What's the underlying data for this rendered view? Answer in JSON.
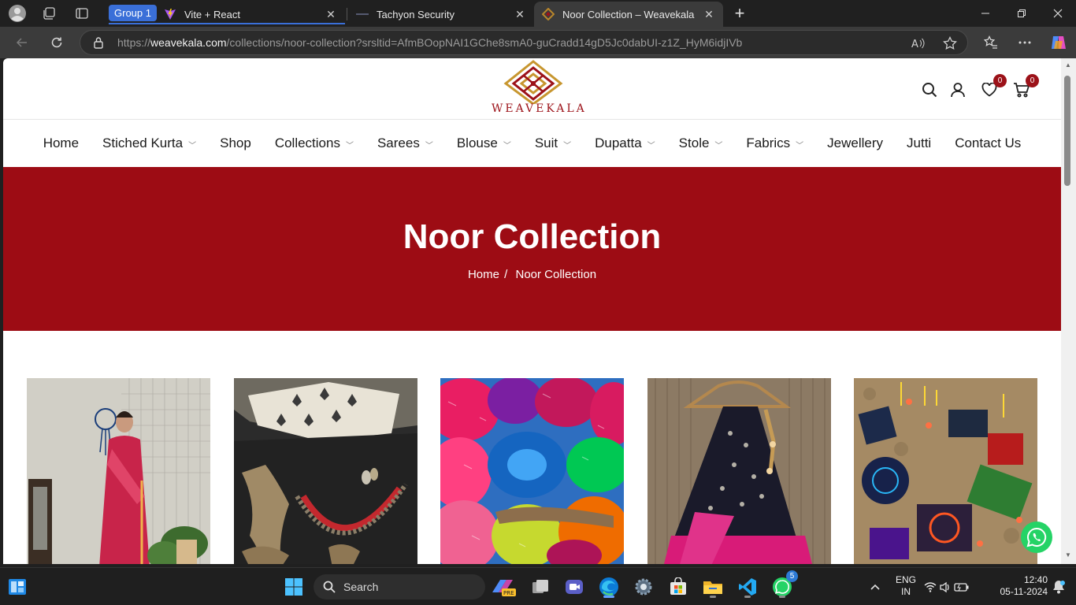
{
  "browser": {
    "tab_group_label": "Group 1",
    "tabs": [
      {
        "title": "Vite + React",
        "favicon": "vite-icon",
        "active": false
      },
      {
        "title": "Tachyon Security",
        "favicon": "tachyon-icon",
        "active": false
      },
      {
        "title": "Noor Collection – Weavekala",
        "favicon": "weavekala-icon",
        "active": true
      }
    ],
    "new_tab_symbol": "+",
    "url_prefix": "https://",
    "url_host": "weavekala.com",
    "url_path": "/collections/noor-collection?srsltid=AfmBOopNAI1GChe8smA0-guCradd14gD5Jc0dabUI-z1Z_HyM6idjIVb"
  },
  "site": {
    "logo_text": "WEAVEKALA",
    "wishlist_count": "0",
    "cart_count": "0",
    "menu": [
      {
        "label": "Home",
        "dropdown": false
      },
      {
        "label": "Stiched Kurta",
        "dropdown": true
      },
      {
        "label": "Shop",
        "dropdown": false
      },
      {
        "label": "Collections",
        "dropdown": true
      },
      {
        "label": "Sarees",
        "dropdown": true
      },
      {
        "label": "Blouse",
        "dropdown": true
      },
      {
        "label": "Suit",
        "dropdown": true
      },
      {
        "label": "Dupatta",
        "dropdown": true
      },
      {
        "label": "Stole",
        "dropdown": true
      },
      {
        "label": "Fabrics",
        "dropdown": true
      },
      {
        "label": "Jewellery",
        "dropdown": false
      },
      {
        "label": "Jutti",
        "dropdown": false
      },
      {
        "label": "Contact Us",
        "dropdown": false
      }
    ],
    "page_title": "Noor Collection",
    "breadcrumb_home": "Home",
    "breadcrumb_sep": "/",
    "breadcrumb_current": "Noor Collection",
    "colors": {
      "brand": "#9d0c14",
      "badge": "#9c1219",
      "whatsapp": "#25d366"
    }
  },
  "taskbar": {
    "search_label": "Search",
    "language": "ENG",
    "region": "IN",
    "time": "12:40",
    "date": "05-11-2024",
    "whatsapp_badge": "5"
  }
}
